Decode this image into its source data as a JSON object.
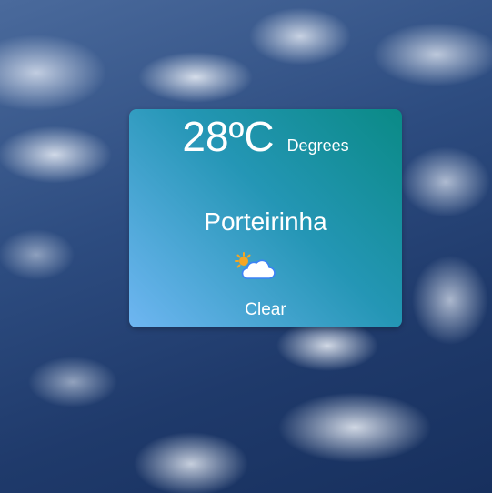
{
  "weather": {
    "temperature": "28ºC",
    "unit_label": "Degrees",
    "city": "Porteirinha",
    "condition": "Clear",
    "icon": "partly-cloudy-sun-icon"
  },
  "colors": {
    "card_gradient_start": "#6fb6f2",
    "card_gradient_end": "#0a8a86",
    "text": "#ffffff",
    "sun": "#f5a623",
    "cloud_fill": "#ffffff",
    "cloud_stroke": "#3b82f6"
  }
}
